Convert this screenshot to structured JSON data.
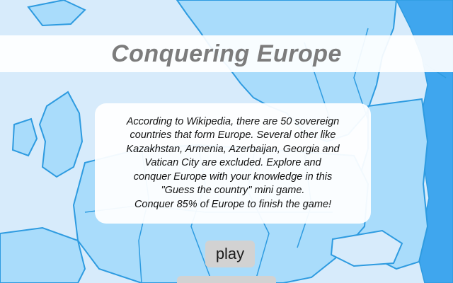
{
  "game": {
    "title": "Conquering Europe"
  },
  "intro": {
    "lines": [
      "According to Wikipedia, there are 50 sovereign",
      "countries that form Europe. Several other like",
      "Kazakhstan, Armenia, Azerbaijan, Georgia and",
      "Vatican City are excluded. Explore and",
      "conquer Europe with your knowledge in this",
      "\"Guess the country\" mini game.",
      "Conquer 85% of Europe to finish the game!"
    ]
  },
  "menu": {
    "play_label": "play"
  },
  "colors": {
    "sea": "#d7ebfb",
    "land": "#a9dcfb",
    "border": "#2e9be0",
    "non_europe_land": "#3fa6ee",
    "title_text": "#7c7c7c",
    "button_bg": "#d2d2d2"
  },
  "icons": {
    "background": "europe-map-background"
  }
}
